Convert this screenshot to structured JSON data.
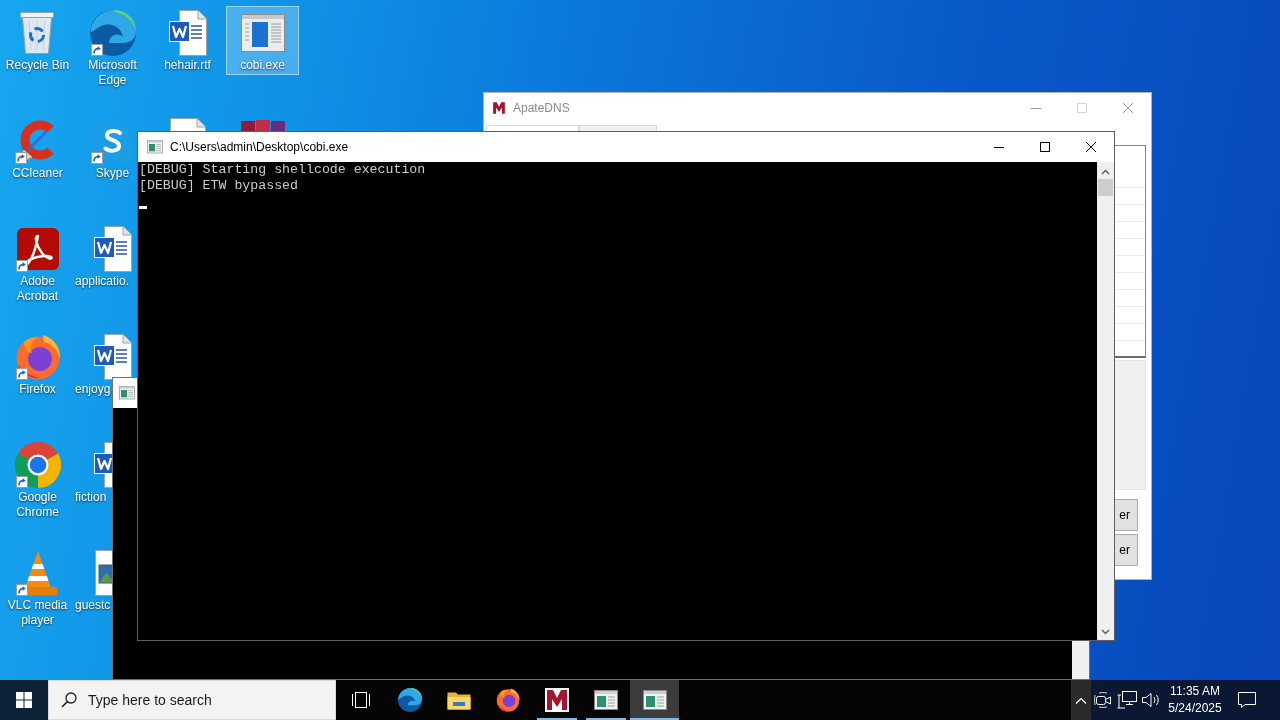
{
  "desktop_columns": [
    [
      {
        "label": "Recycle Bin",
        "kind": "recycle-bin",
        "shortcut": false,
        "covered": false,
        "selected": false
      },
      {
        "label": "CCleaner",
        "kind": "ccleaner",
        "shortcut": true,
        "covered": false,
        "selected": false
      },
      {
        "label": "Adobe Acrobat",
        "kind": "acrobat",
        "shortcut": true,
        "covered": false,
        "selected": false
      },
      {
        "label": "Firefox",
        "kind": "firefox",
        "shortcut": true,
        "covered": false,
        "selected": false
      },
      {
        "label": "Google Chrome",
        "kind": "chrome",
        "shortcut": true,
        "covered": false,
        "selected": false
      },
      {
        "label": "VLC media player",
        "kind": "vlc",
        "shortcut": true,
        "covered": false,
        "selected": false
      }
    ],
    [
      {
        "label": "Microsoft Edge",
        "kind": "edge",
        "shortcut": true,
        "covered": false,
        "selected": false
      },
      {
        "label": "Skype",
        "kind": "skype",
        "shortcut": true,
        "covered": false,
        "selected": false
      },
      {
        "label": "applicatio.",
        "kind": "word",
        "shortcut": false,
        "covered": true,
        "selected": false
      },
      {
        "label": "enjoyg",
        "kind": "word",
        "shortcut": false,
        "covered": true,
        "selected": false
      },
      {
        "label": "fiction",
        "kind": "word",
        "shortcut": false,
        "covered": true,
        "selected": false
      },
      {
        "label": "guestc",
        "kind": "image",
        "shortcut": false,
        "covered": true,
        "selected": false
      }
    ],
    [
      {
        "label": "hehair.rtf",
        "kind": "word",
        "shortcut": false,
        "covered": false,
        "selected": false
      },
      {
        "kind": "file",
        "selected": false
      }
    ],
    [
      {
        "label": "cobi.exe",
        "kind": "exe",
        "shortcut": false,
        "covered": false,
        "selected": true
      },
      {
        "kind": "archive",
        "selected": false
      }
    ]
  ],
  "apatedns_window": {
    "title": "ApateDNS",
    "active": false,
    "can_maximize": false,
    "tabs": [
      {
        "selected": true
      },
      {
        "selected": false
      }
    ],
    "buttons": [
      "er",
      "er"
    ]
  },
  "console_window": {
    "title": "C:\\Users\\admin\\Desktop\\cobi.exe",
    "active": true,
    "lines": [
      "[DEBUG] Starting shellcode execution",
      "[DEBUG] ETW bypassed"
    ]
  },
  "taskbar": {
    "search": {
      "placeholder": "Type here to search"
    },
    "apps": [
      {
        "kind": "edge",
        "open": false,
        "selected": false
      },
      {
        "kind": "explorer",
        "open": false,
        "selected": false
      },
      {
        "kind": "firefox",
        "open": false,
        "selected": false
      },
      {
        "kind": "apatedns",
        "open": true,
        "selected": false
      },
      {
        "kind": "console",
        "open": true,
        "selected": false
      },
      {
        "kind": "console",
        "open": true,
        "selected": true
      }
    ],
    "clock": {
      "time": "11:35 AM",
      "date": "5/24/2025"
    }
  }
}
